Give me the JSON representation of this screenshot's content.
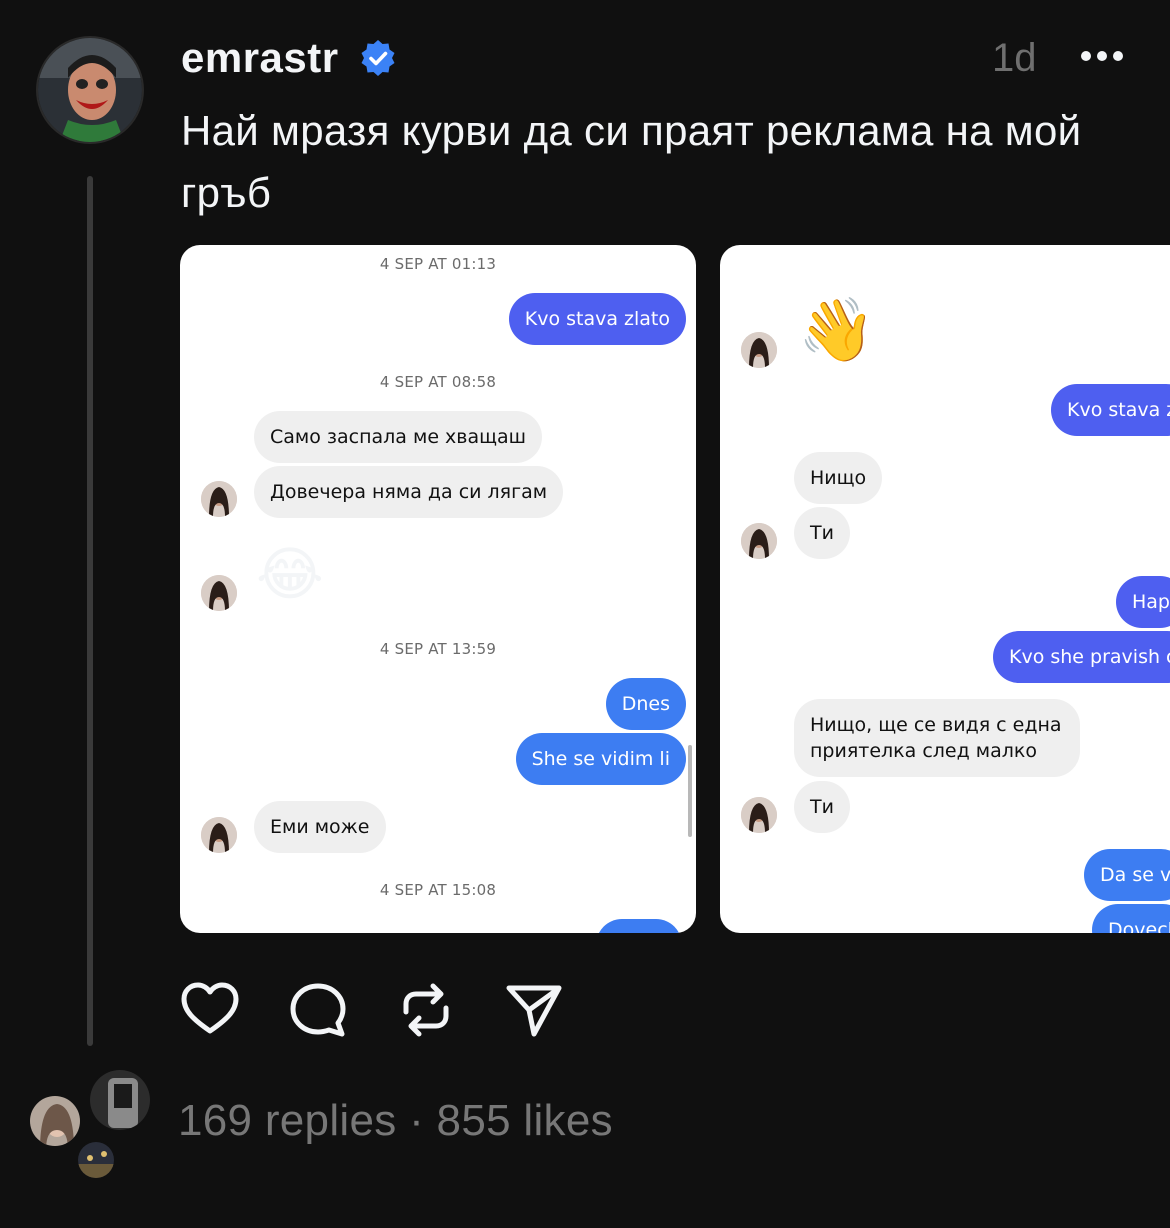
{
  "post": {
    "username": "emrastr",
    "time": "1d",
    "text": "Най мразя курви да си праят реклама на мой гръб"
  },
  "card_a": {
    "timestamps": [
      "4 SEP AT 01:13",
      "4 SEP AT 08:58",
      "4 SEP AT 13:59",
      "4 SEP AT 15:08"
    ],
    "messages": {
      "m1": "Kvo stava zlato",
      "m2": "Само заспала ме хващаш",
      "m3": "Довечера няма да си лягам",
      "m4": "😂",
      "m5": "Dnes",
      "m6": "She se vidim li",
      "m7": "Еми може"
    }
  },
  "card_b": {
    "messages": {
      "m1": "👋",
      "m2": "Kvo stava z",
      "m3": "Нищо",
      "m4": "Ти",
      "m5": "Hap",
      "m6": "Kvo she pravish c",
      "m7": "Нищо, ще се видя с една приятелка след малко",
      "m8": "Ти",
      "m9": "Da se v",
      "m10": "Dovecl"
    }
  },
  "footer": {
    "stats": "169 replies · 855 likes"
  },
  "icons": [
    "verified-badge-icon",
    "more-icon",
    "heart-icon",
    "comment-icon",
    "repost-icon",
    "share-icon"
  ],
  "colors": {
    "background": "#101010",
    "verified": "#3b82f6",
    "outgoing_bubble": "#4e5ff0",
    "outgoing_bubble_alt": "#3d7df2",
    "incoming_bubble": "#efefef"
  }
}
